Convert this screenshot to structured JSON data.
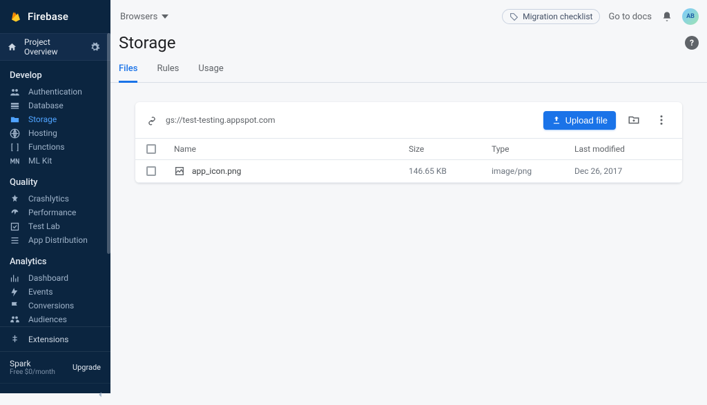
{
  "brand": {
    "name": "Firebase"
  },
  "home": {
    "label": "Project Overview"
  },
  "sections": {
    "develop": {
      "title": "Develop",
      "items": [
        {
          "label": "Authentication"
        },
        {
          "label": "Database"
        },
        {
          "label": "Storage"
        },
        {
          "label": "Hosting"
        },
        {
          "label": "Functions"
        },
        {
          "label": "ML Kit"
        }
      ]
    },
    "quality": {
      "title": "Quality",
      "items": [
        {
          "label": "Crashlytics"
        },
        {
          "label": "Performance"
        },
        {
          "label": "Test Lab"
        },
        {
          "label": "App Distribution"
        }
      ]
    },
    "analytics": {
      "title": "Analytics",
      "items": [
        {
          "label": "Dashboard"
        },
        {
          "label": "Events"
        },
        {
          "label": "Conversions"
        },
        {
          "label": "Audiences"
        }
      ]
    }
  },
  "extensions": {
    "label": "Extensions"
  },
  "plan": {
    "name": "Spark",
    "sub": "Free $0/month",
    "upgrade": "Upgrade"
  },
  "topbar": {
    "project": "Browsers",
    "migration": "Migration checklist",
    "docs": "Go to docs",
    "avatar": "AB"
  },
  "page": {
    "title": "Storage"
  },
  "tabs": [
    {
      "label": "Files"
    },
    {
      "label": "Rules"
    },
    {
      "label": "Usage"
    }
  ],
  "bucket": {
    "uri": "gs://test-testing.appspot.com"
  },
  "toolbar": {
    "upload": "Upload file"
  },
  "columns": {
    "name": "Name",
    "size": "Size",
    "type": "Type",
    "modified": "Last modified"
  },
  "files": [
    {
      "name": "app_icon.png",
      "size": "146.65 KB",
      "type": "image/png",
      "modified": "Dec 26, 2017"
    }
  ],
  "help": {
    "label": "?"
  }
}
